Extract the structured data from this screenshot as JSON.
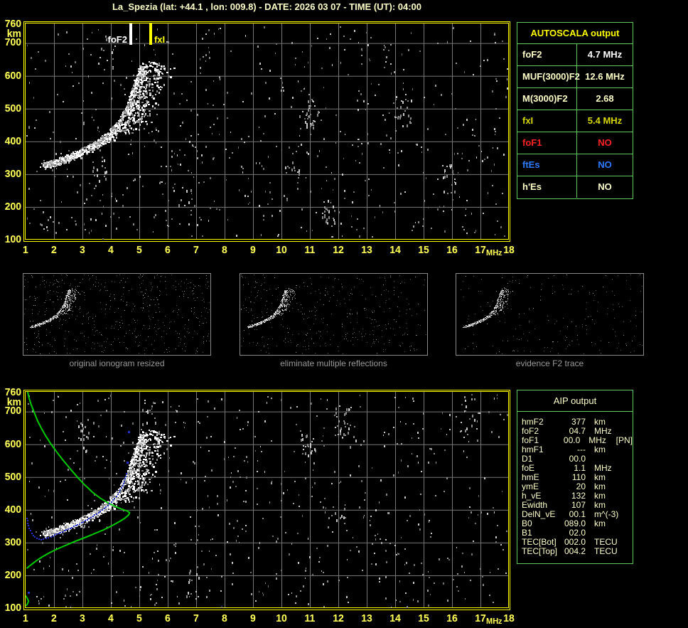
{
  "header": {
    "title": "La_Spezia (lat: +44.1 , lon: 009.8) - DATE: 2026 03 07 - TIME (UT): 04:00"
  },
  "autoscala_table": {
    "title": "AUTOSCALA output",
    "rows": [
      {
        "label": "foF2",
        "value": "4.7 MHz",
        "color": "#ffffc8",
        "value_color": "#ffffff"
      },
      {
        "label": "MUF(3000)F2",
        "value": "12.6 MHz",
        "color": "#ffffc8",
        "value_color": "#ffffc8"
      },
      {
        "label": "M(3000)F2",
        "value": "2.68",
        "color": "#ffffc8",
        "value_color": "#ffffc8"
      },
      {
        "label": "fxI",
        "value": "5.4 MHz",
        "color": "#d8d800",
        "value_color": "#d8d800"
      },
      {
        "label": "foF1",
        "value": "NO",
        "color": "#ff2222",
        "value_color": "#ff2222"
      },
      {
        "label": "ftEs",
        "value": "NO",
        "color": "#2b7bff",
        "value_color": "#2b7bff"
      },
      {
        "label": "h'Es",
        "value": "NO",
        "color": "#ffffc8",
        "value_color": "#ffffc8"
      }
    ]
  },
  "aip_table": {
    "title": "AIP output",
    "rows": [
      {
        "label": "hmF2",
        "value": "377",
        "unit": "km",
        "extra": ""
      },
      {
        "label": "foF2",
        "value": "04.7",
        "unit": "MHz",
        "extra": ""
      },
      {
        "label": "foF1",
        "value": "00.0",
        "unit": "MHz",
        "extra": "[PN]"
      },
      {
        "label": "hmF1",
        "value": "---",
        "unit": "km",
        "extra": ""
      },
      {
        "label": "D1",
        "value": "00.0",
        "unit": "",
        "extra": ""
      },
      {
        "label": "foE",
        "value": "1.1",
        "unit": "MHz",
        "extra": ""
      },
      {
        "label": "hmE",
        "value": "110",
        "unit": "km",
        "extra": ""
      },
      {
        "label": "ymE",
        "value": "20",
        "unit": "km",
        "extra": ""
      },
      {
        "label": "h_vE",
        "value": "132",
        "unit": "km",
        "extra": ""
      },
      {
        "label": "Ewidth",
        "value": "107",
        "unit": "km",
        "extra": ""
      },
      {
        "label": "DelN_vE",
        "value": "00.1",
        "unit": "m^(-3)",
        "extra": ""
      },
      {
        "label": "B0",
        "value": "089.0",
        "unit": "km",
        "extra": ""
      },
      {
        "label": "B1",
        "value": "02.0",
        "unit": "",
        "extra": ""
      },
      {
        "label": "TEC[Bot]",
        "value": "002.0",
        "unit": "TECU",
        "extra": ""
      },
      {
        "label": "TEC[Top]",
        "value": "004.2",
        "unit": "TECU",
        "extra": ""
      }
    ]
  },
  "thumbnails": [
    {
      "caption": "original ionogram resized"
    },
    {
      "caption": "eliminate multiple reflections"
    },
    {
      "caption": "evidence F2 trace"
    }
  ],
  "colors": {
    "plot_border": "#ffff00",
    "grid": "#777777",
    "axis_label": "#ffff55",
    "table_border": "#5ecb5e",
    "green_curve": "#00cc00",
    "blue_trace": "#2233cc",
    "caption": "#9a9a9a"
  },
  "chart_data": {
    "type": "scatter",
    "description": "Ionogram: virtual height (km) vs sounding frequency (MHz); top plot with autoscaled foF2/fxI markers, bottom plot with inverted electron density profile (green) and fitted trace (blue)",
    "xlabel": "MHz",
    "ylabel": "km",
    "xlim": [
      1,
      18
    ],
    "ylim": [
      100,
      760
    ],
    "grid": true,
    "x_ticks": [
      1,
      2,
      3,
      4,
      5,
      6,
      7,
      8,
      9,
      10,
      11,
      12,
      13,
      14,
      15,
      16,
      17,
      18
    ],
    "y_ticks": [
      760,
      700,
      600,
      500,
      400,
      300,
      200,
      100
    ],
    "top_markers": [
      {
        "label": "foF2",
        "freq_mhz": 4.7,
        "color": "#ffffff"
      },
      {
        "label": "fxI",
        "freq_mhz": 5.4,
        "color": "#ffff00"
      }
    ],
    "f2_trace_fh": [
      [
        1.55,
        327
      ],
      [
        1.75,
        331
      ],
      [
        1.95,
        337
      ],
      [
        2.15,
        343
      ],
      [
        2.35,
        350
      ],
      [
        2.55,
        357
      ],
      [
        2.75,
        364
      ],
      [
        2.95,
        372
      ],
      [
        3.15,
        381
      ],
      [
        3.35,
        390
      ],
      [
        3.55,
        401
      ],
      [
        3.75,
        413
      ],
      [
        3.95,
        427
      ],
      [
        4.12,
        443
      ],
      [
        4.28,
        460
      ],
      [
        4.42,
        478
      ],
      [
        4.52,
        497
      ],
      [
        4.62,
        517
      ],
      [
        4.7,
        539
      ],
      [
        4.78,
        561
      ],
      [
        4.86,
        583
      ],
      [
        4.94,
        604
      ],
      [
        5.03,
        622
      ],
      [
        5.12,
        638
      ]
    ],
    "profile_green_fh": [
      [
        1.07,
        760
      ],
      [
        1.12,
        742
      ],
      [
        1.2,
        720
      ],
      [
        1.3,
        698
      ],
      [
        1.42,
        672
      ],
      [
        1.56,
        648
      ],
      [
        1.72,
        624
      ],
      [
        1.9,
        600
      ],
      [
        2.1,
        576
      ],
      [
        2.33,
        550
      ],
      [
        2.58,
        524
      ],
      [
        2.82,
        500
      ],
      [
        3.08,
        476
      ],
      [
        3.35,
        454
      ],
      [
        3.62,
        436
      ],
      [
        3.9,
        421
      ],
      [
        4.18,
        409
      ],
      [
        4.42,
        401
      ],
      [
        4.58,
        396
      ],
      [
        4.66,
        391
      ],
      [
        4.62,
        384
      ],
      [
        4.5,
        375
      ],
      [
        4.3,
        364
      ],
      [
        4.05,
        352
      ],
      [
        3.75,
        339
      ],
      [
        3.42,
        327
      ],
      [
        3.08,
        315
      ],
      [
        2.75,
        304
      ],
      [
        2.42,
        292
      ],
      [
        2.1,
        280
      ],
      [
        1.82,
        268
      ],
      [
        1.58,
        256
      ],
      [
        1.4,
        246
      ],
      [
        1.25,
        236
      ],
      [
        1.13,
        228
      ],
      [
        1.04,
        221
      ]
    ],
    "e_layer_green_fh": [
      [
        1.0,
        138
      ],
      [
        1.06,
        130
      ],
      [
        1.1,
        121
      ],
      [
        1.07,
        113
      ],
      [
        1.01,
        106
      ]
    ],
    "fitted_trace_blue_fh": [
      [
        1.05,
        374
      ],
      [
        1.1,
        352
      ],
      [
        1.17,
        336
      ],
      [
        1.27,
        322
      ],
      [
        1.4,
        312
      ],
      [
        1.55,
        308
      ],
      [
        1.72,
        312
      ],
      [
        1.9,
        318
      ],
      [
        2.1,
        325
      ],
      [
        2.3,
        333
      ],
      [
        2.5,
        341
      ],
      [
        2.7,
        349
      ],
      [
        2.9,
        357
      ],
      [
        3.1,
        366
      ],
      [
        3.3,
        376
      ],
      [
        3.5,
        387
      ],
      [
        3.7,
        399
      ],
      [
        3.9,
        413
      ],
      [
        4.08,
        429
      ],
      [
        4.25,
        447
      ],
      [
        4.38,
        466
      ],
      [
        4.48,
        487
      ],
      [
        4.55,
        510
      ]
    ],
    "blue_dots_fh": [
      [
        4.58,
        545
      ],
      [
        4.62,
        638
      ],
      [
        1.1,
        147
      ]
    ],
    "noise": {
      "seed": 1337,
      "uniform_count": 620,
      "cluster_count": 9
    }
  }
}
